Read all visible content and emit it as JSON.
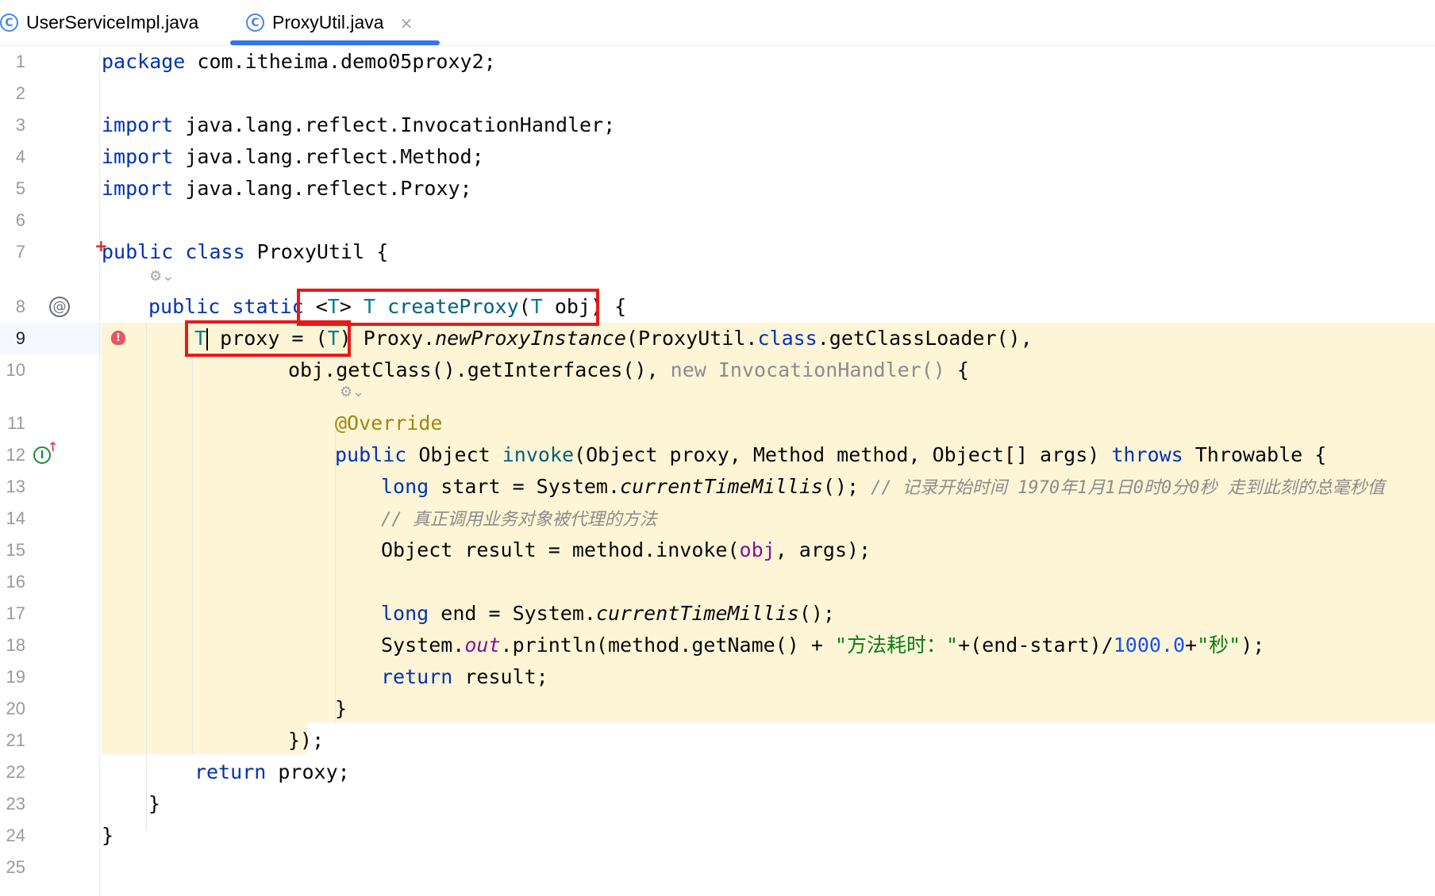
{
  "tabs": [
    {
      "label": "UserServiceImpl.java",
      "icon": "java-class-icon",
      "active": false
    },
    {
      "label": "ProxyUtil.java",
      "icon": "java-class-icon",
      "active": true,
      "close": "×"
    }
  ],
  "lines": {
    "numbers": [
      "1",
      "2",
      "3",
      "4",
      "5",
      "6",
      "7",
      "8",
      "9",
      "10",
      "11",
      "12",
      "13",
      "14",
      "15",
      "16",
      "17",
      "18",
      "19",
      "20",
      "21",
      "22",
      "23",
      "24",
      "25"
    ],
    "current_line": "9",
    "l1": {
      "kw": "package",
      "rest": " com.itheima.demo05proxy2;"
    },
    "l3": {
      "kw": "import",
      "rest": " java.lang.reflect.InvocationHandler;"
    },
    "l4": {
      "kw": "import",
      "rest": " java.lang.reflect.Method;"
    },
    "l5": {
      "kw": "import",
      "rest": " java.lang.reflect.Proxy;"
    },
    "l7": {
      "kw1": "public",
      "kw2": " class",
      "name": " ProxyUtil",
      "brace": " {"
    },
    "l8": {
      "kw1": "public",
      "kw2": " static",
      "sp": " ",
      "lt": "<",
      "T1": "T",
      "gt": ">",
      "sp2": " ",
      "T2": "T",
      "fn": " createProxy",
      "p1": "(",
      "T3": "T",
      "arg": " obj",
      "p2": ")",
      "brace": " {"
    },
    "l9": {
      "T1": "T",
      "mid": " proxy = (",
      "T2": "T",
      "p": ")",
      "s1": " Proxy.",
      "method": "newProxyInstance",
      "s2": "(ProxyUtil.",
      "cls": "class",
      "s3": ".getClassLoader(),"
    },
    "l10": {
      "s1": "obj.getClass().getInterfaces(), ",
      "gray": "new InvocationHandler()",
      "s2": " {"
    },
    "l11": {
      "ann": "@Override"
    },
    "l12": {
      "kw": "public",
      "s1": " Object ",
      "fn": "invoke",
      "s2": "(Object proxy, Method method, Object[] args) ",
      "kw2": "throws",
      "s3": " Throwable {"
    },
    "l13": {
      "kw": "long",
      "s1": " start = System.",
      "method": "currentTimeMillis",
      "s2": "(); ",
      "cmt": "// 记录开始时间 1970年1月1日0时0分0秒 走到此刻的总毫秒值"
    },
    "l14": {
      "cmt": "// 真正调用业务对象被代理的方法"
    },
    "l15": {
      "s1": "Object result = method.invoke(",
      "param": "obj",
      "s2": ", args);"
    },
    "l17": {
      "kw": "long",
      "s1": " end = System.",
      "method": "currentTimeMillis",
      "s2": "();"
    },
    "l18": {
      "s1": "System.",
      "field": "out",
      "s2": ".println(method.getName() + ",
      "str1": "\"方法耗时：\"",
      "s3": "+(end-start)/",
      "num": "1000.0",
      "s4": "+",
      "str2": "\"秒\"",
      "s5": ");"
    },
    "l19": {
      "kw": "return",
      "s1": " result;"
    },
    "l20": {
      "s1": "}"
    },
    "l21": {
      "s1": "});"
    },
    "l22": {
      "kw": "return",
      "s1": " proxy;"
    },
    "l23": {
      "s1": "}"
    },
    "l24": {
      "s1": "}"
    }
  },
  "gutter_icons": [
    "implements-icon",
    "at-annotation-icon",
    "error-bulb-icon",
    "ai-hint-icon"
  ],
  "colors": {
    "keyword": "#0033b3",
    "type_param": "#007e8a",
    "method_decl": "#00627a",
    "annotation": "#9e880d",
    "string": "#067d17",
    "number": "#1750eb",
    "comment": "#8c8c8c",
    "highlight_bg": "#fdf5d6",
    "tab_underline": "#3574f0",
    "red_box": "#e81919"
  }
}
